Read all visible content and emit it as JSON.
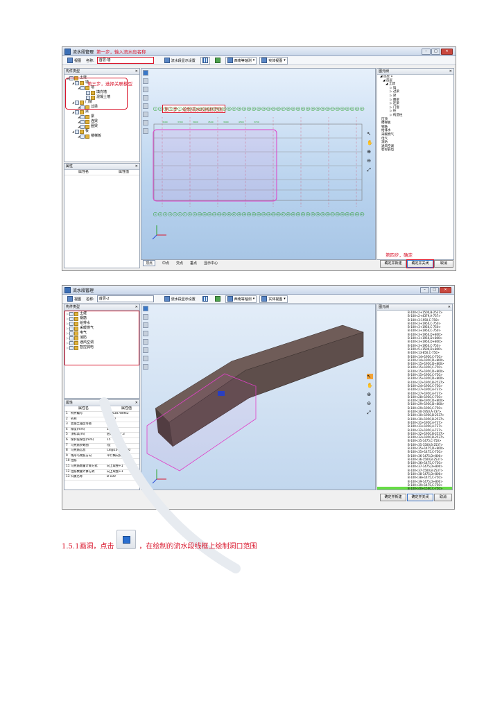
{
  "screenshot1": {
    "window_title": "流水段管理",
    "toolbar": {
      "view_label": "视图",
      "name_label": "名称:",
      "name_value": "首层-墙",
      "settings_label": "流水段显示设置",
      "view_dropdown": "西南等轴测",
      "mode_dropdown": "实体视图"
    },
    "left_tree_header": "构件类型",
    "left_tree": [
      {
        "label": "土建",
        "level": 0
      },
      {
        "label": "墙",
        "level": 1
      },
      {
        "label": "墙",
        "level": 2
      },
      {
        "label": "填充墙",
        "level": 3
      },
      {
        "label": "混凝土墙",
        "level": 3
      },
      {
        "label": "门窗",
        "level": 1
      },
      {
        "label": "过梁",
        "level": 2
      },
      {
        "label": "梁",
        "level": 1
      },
      {
        "label": "梁",
        "level": 2
      },
      {
        "label": "连梁",
        "level": 2
      },
      {
        "label": "圈梁",
        "level": 2
      },
      {
        "label": "板",
        "level": 1
      },
      {
        "label": "楼梯板",
        "level": 2
      }
    ],
    "prop_header": "属性",
    "prop_col_name": "属性名",
    "prop_col_value": "属性值",
    "right_header": "图元树",
    "right_tree": [
      "首层-1",
      "首层",
      "土建",
      "墙",
      "过梁",
      "梁",
      "圈梁",
      "连梁",
      "门窗",
      "柱",
      "构造柱",
      "压顶",
      "楼梯板",
      "钢筋",
      "给排水",
      "采暖燃气",
      "电气",
      "消防",
      "通风空调",
      "智控弱电"
    ],
    "annotations": {
      "step1": "第一步，输入流水段名称",
      "step2": "第二步，绘制流水段线框范围",
      "step3": "第三步，选择关联模型",
      "step4": "第四步，确定"
    },
    "snap_bar": [
      "顶点",
      "中点",
      "交点",
      "垂点",
      "显示中心"
    ],
    "buttons": {
      "confirm_new": "确定并新建",
      "confirm_close": "确定并关闭",
      "cancel": "取消"
    },
    "axis_labels": [
      "1",
      "2",
      "3",
      "4",
      "5",
      "6",
      "7",
      "8",
      "9",
      "10",
      "11",
      "12",
      "13",
      "14",
      "15",
      "16",
      "17",
      "18",
      "19",
      "20",
      "21",
      "22",
      "23",
      "24",
      "25",
      "26",
      "27",
      "28",
      "29",
      "30",
      "31",
      "32",
      "33",
      "34",
      "35",
      "36",
      "37",
      "38",
      "39",
      "40",
      "41",
      "42",
      "43"
    ],
    "dims": [
      "4500",
      "3700",
      "3900",
      "4500",
      "3900",
      "4500",
      "3700"
    ]
  },
  "screenshot2": {
    "window_title": "流水段管理",
    "toolbar": {
      "view_label": "视图",
      "name_label": "名称:",
      "name_value": "首层-2",
      "settings_label": "流水段显示设置",
      "view_dropdown": "西南等轴测",
      "mode_dropdown": "实体视图"
    },
    "left_tree_header": "构件类型",
    "left_tree": [
      "土建",
      "钢筋",
      "给排水",
      "采暖燃气",
      "电气",
      "消防",
      "通风空调",
      "智控弱电"
    ],
    "prop_header": "属性",
    "prop_col_name": "属性名",
    "prop_col_value": "属性值",
    "props": [
      {
        "no": "1",
        "name": "构件编号",
        "value": "5b9630780f42"
      },
      {
        "no": "2",
        "name": "名称",
        "value": "B-100"
      },
      {
        "no": "3",
        "name": "混凝土强度等级",
        "value": "C30"
      },
      {
        "no": "4",
        "name": "厚度(mm)",
        "value": "100"
      },
      {
        "no": "5",
        "name": "顶标高(m)",
        "value": "层顶标高(7.3"
      },
      {
        "no": "6",
        "name": "保护层厚度(mm)",
        "value": "15"
      },
      {
        "no": "7",
        "name": "马凳筋参数图",
        "value": "I型"
      },
      {
        "no": "8",
        "name": "马凳筋信息",
        "value": "C8@1000*1000"
      },
      {
        "no": "9",
        "name": "线形马凳筋方向",
        "value": "平行横向受力"
      },
      {
        "no": "10",
        "name": "拉筋",
        "value": ""
      },
      {
        "no": "11",
        "name": "马凳筋数量计算方式",
        "value": "向上取整+1"
      },
      {
        "no": "12",
        "name": "拉筋数量计算方式",
        "value": "向上取整+1"
      },
      {
        "no": "13",
        "name": "归类名称",
        "value": "B-100"
      }
    ],
    "right_header": "图元树",
    "right_list": [
      "B-100<2+1500,B-2537>",
      "B-100<2+4379,A-737>",
      "B-100<3-1950,C-750>",
      "B-100<3+1950,C-750>",
      "B-100<3+1950,C-750>",
      "B-100<3+1950,C-750>",
      "B-100<3+1950,D+800>",
      "B-100<3+1950,D+800>",
      "B-100<3+1950,D+800>",
      "B-100<3+1950,C-750>",
      "B-100<5+1500,D+800>",
      "B-100<13-850,C-750>",
      "B-100<14+1950,C-750>",
      "B-100<14+1950,D+800>",
      "B-100<15+1950,D+800>",
      "B-100<15+1950,C-750>",
      "B-100<15+1950,D+800>",
      "B-100<15+1950,C-750>",
      "B-100<15+1950,D+800>",
      "B-100<22+1950,B-2537>",
      "B-100<24+1950,C-750>",
      "B-100<27+1950,A-737>",
      "B-100<27+1950,A-737>",
      "B-100<28+1950,C-750>",
      "B-100<28+1950,D+800>",
      "B-100<29+1950,D+800>",
      "B-100<29+1950,C-750>",
      "B-100<30-1950,A-737>",
      "B-100<30+1950,B-2537>",
      "B-100<30+1950,B-2537>",
      "B-100<31+1950,A-737>",
      "B-100<31+1950,A-737>",
      "B-100<32+1950,A-737>",
      "B-100<32+1950,B-2537>",
      "B-100<32+1950,B-2537>",
      "B-100<35-1475,C-750>",
      "B-100<35-1500,B-2537>",
      "B-100<35+1475,D+800>",
      "B-100<35+1475,C-750>",
      "B-100<36-1475,D+800>",
      "B-100<36-1500,B-2537>",
      "B-100<36+1475,C-750>",
      "B-100<37-1475,D+800>",
      "B-100<37-1500,B-2537>",
      "B-100<38-1475,D+800>",
      "B-100<38+1475,C-750>",
      "B-100<39-1475,D+800>",
      "B-100<39+1475,C-750>",
      "B-100<40+1500,C-750>"
    ],
    "buttons": {
      "confirm_new": "确定并新建",
      "confirm_close": "确定并关闭",
      "cancel": "取消"
    }
  },
  "caption": {
    "before": "1.5.1画洞，点击",
    "after": "，在绘制的流水段线框上绘制洞口范围"
  },
  "colors": {
    "annotation_red": "#d9152b",
    "highlight_green": "#66dd44",
    "selection_pink": "#e040c8"
  }
}
